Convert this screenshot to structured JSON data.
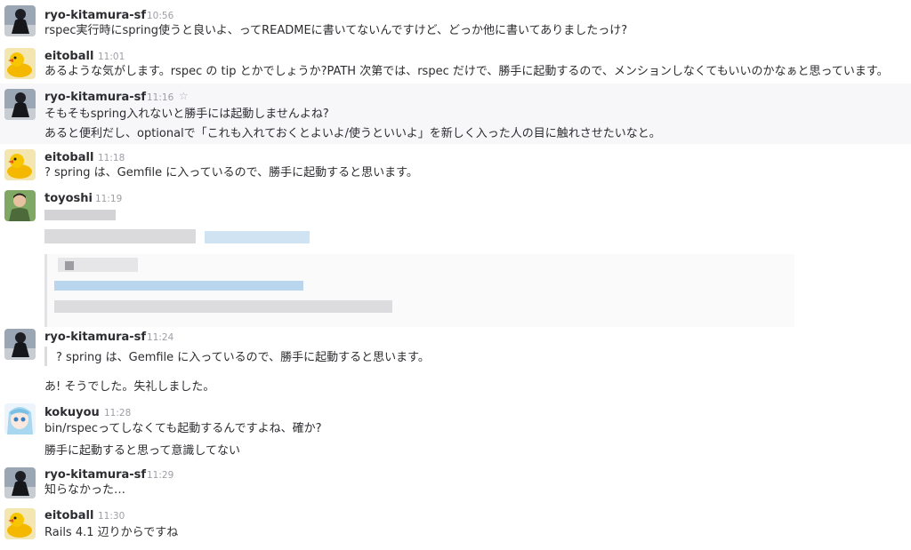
{
  "messages": [
    {
      "user": "ryo-kitamura-sf",
      "time": "10:56",
      "lines": [
        "rspec実行時にspring使うと良いよ、ってREADMEに書いてないんですけど、どっか他に書いてありましたっけ?"
      ]
    },
    {
      "user": "eitoball",
      "time": "11:01",
      "lines": [
        "あるような気がします。rspec の tip とかでしょうか?PATH 次第では、rspec だけで、勝手に起動するので、メンションしなくてもいいのかなぁと思っています。"
      ]
    },
    {
      "user": "ryo-kitamura-sf",
      "time": "11:16",
      "lines": [
        "そもそもspring入れないと勝手には起動しませんよね?",
        "あると便利だし、optionalで「これも入れておくとよいよ/使うといいよ」を新しく入った人の目に触れさせたいなと。"
      ]
    },
    {
      "user": "eitoball",
      "time": "11:18",
      "lines": [
        "? spring は、Gemfile に入っているので、勝手に起動すると思います。"
      ]
    },
    {
      "user": "toyoshi",
      "time": "11:19",
      "lines": []
    },
    {
      "user": "ryo-kitamura-sf",
      "time": "11:24",
      "quote": "? spring は、Gemfile に入っているので、勝手に起動すると思います。",
      "lines": [
        "あ! そうでした。失礼しました。"
      ]
    },
    {
      "user": "kokuyou",
      "time": "11:28",
      "lines": [
        "bin/rspecってしなくても起動するんですよね、確か?",
        "勝手に起動すると思って意識してない"
      ]
    },
    {
      "user": "ryo-kitamura-sf",
      "time": "11:29",
      "lines": [
        "知らなかった…"
      ]
    },
    {
      "user": "eitoball",
      "time": "11:30",
      "lines": [
        "Rails 4.1 辺りからですね"
      ]
    }
  ],
  "icons": {
    "star": "☆",
    "avatar_ryo": "person-in-dark-jacket-avatar",
    "avatar_eitoball": "rubber-duck-avatar",
    "avatar_toyoshi": "man-in-green-avatar",
    "avatar_kokuyou": "anime-character-avatar"
  },
  "colors": {
    "username": "#2c2d30",
    "timestamp": "#9e9ea6",
    "highlight_row": "#f7f7f9",
    "quote_bar": "#dcdcdf"
  }
}
